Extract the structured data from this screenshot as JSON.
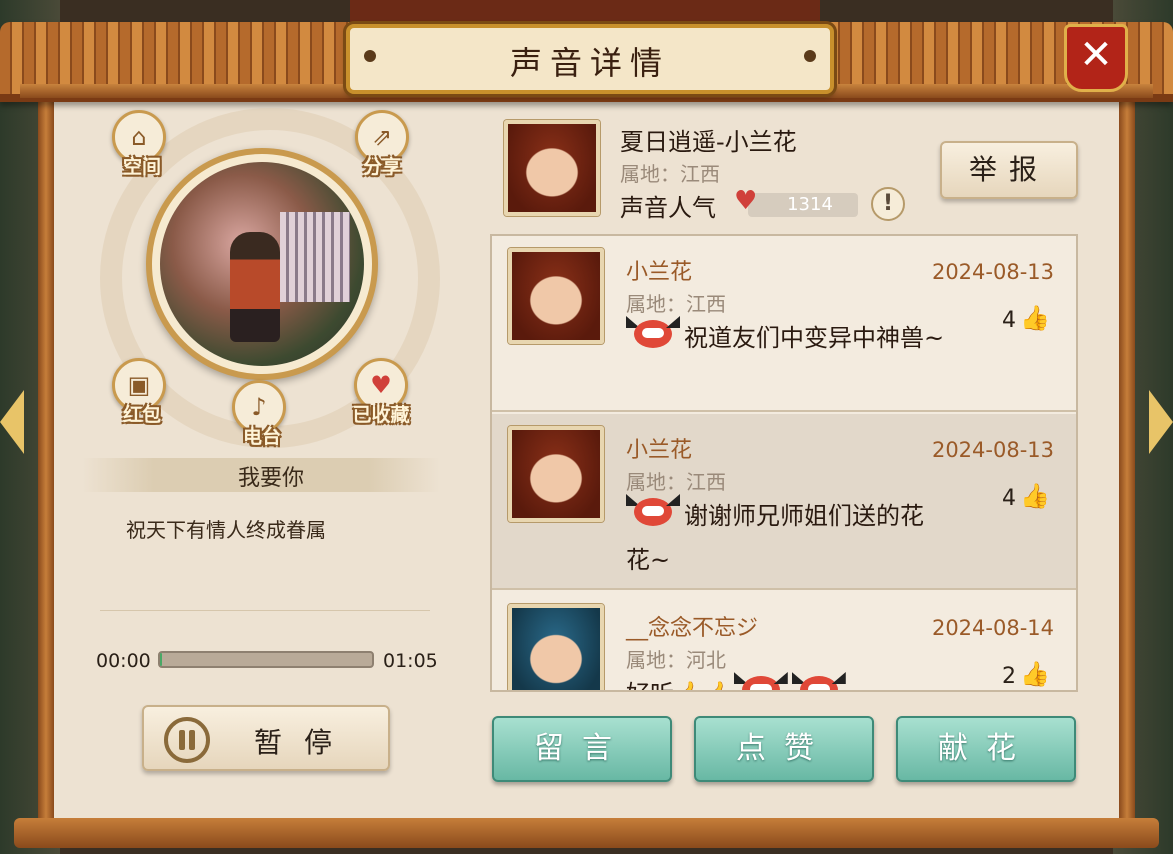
{
  "dialog": {
    "title": "声音详情",
    "close_symbol": "✕"
  },
  "left": {
    "buttons": {
      "space": {
        "label": "空间",
        "icon": "home-icon"
      },
      "share": {
        "label": "分享",
        "icon": "share-icon"
      },
      "red_packet": {
        "label": "红包",
        "icon": "red-packet-icon"
      },
      "radio": {
        "label": "电台",
        "icon": "gramophone-icon"
      },
      "favorite": {
        "label": "已收藏",
        "icon": "heart-icon"
      }
    },
    "song_title": "我要你",
    "song_description": "祝天下有情人终成眷属",
    "player": {
      "current_time": "00:00",
      "total_time": "01:05",
      "progress_fraction": 0.01,
      "pause_label": "暂停"
    }
  },
  "profile": {
    "name": "夏日逍遥-小兰花",
    "location": "属地：江西",
    "popularity_label": "声音人气",
    "popularity_value": "1314",
    "info_symbol": "!",
    "report_label": "举报"
  },
  "comments": [
    {
      "name": "小兰花",
      "location": "属地：江西",
      "date": "2024-08-13",
      "likes": "4",
      "text": "祝道友们中变异中神兽~",
      "avatar": "red"
    },
    {
      "name": "小兰花",
      "location": "属地：江西",
      "date": "2024-08-13",
      "likes": "4",
      "text": "谢谢师兄师姐们送的花花~",
      "avatar": "red"
    },
    {
      "name": "__念念不忘ジ",
      "location": "属地：河北",
      "date": "2024-08-14",
      "likes": "2",
      "text": "好听",
      "avatar": "blue"
    }
  ],
  "actions": {
    "comment_label": "留言",
    "like_label": "点赞",
    "flower_label": "献花"
  },
  "colors": {
    "accent_green": "#68b8a4",
    "title_brown": "#9a5a28",
    "heart_red": "#d0403a"
  }
}
